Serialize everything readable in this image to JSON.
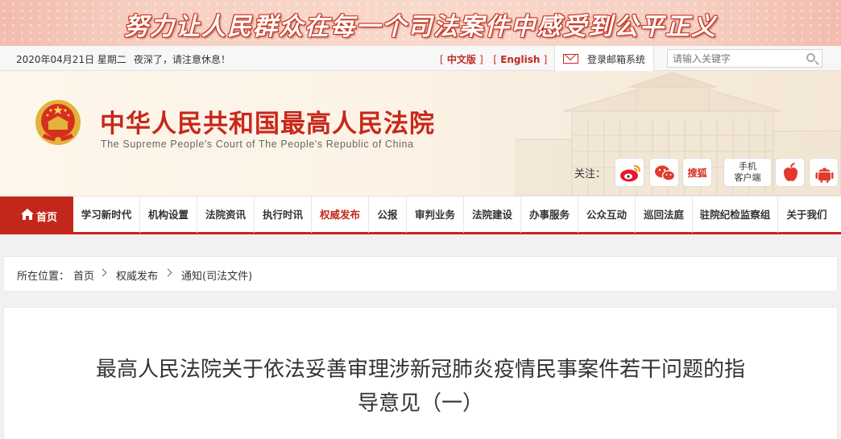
{
  "banner": {
    "slogan": "努力让人民群众在每一个司法案件中感受到公平正义"
  },
  "topbar": {
    "date": "2020年04月21日 星期二",
    "greeting": "夜深了，请注意休息！",
    "lang_cn": "中文版",
    "lang_en": "English",
    "mail_label": "登录邮箱系统",
    "search_placeholder": "请输入关键字"
  },
  "header": {
    "title": "中华人民共和国最高人民法院",
    "subtitle": "The Supreme People's Court of The People's Republic of China",
    "follow_label": "关注：",
    "sohu_label": "搜狐",
    "mobile_label_1": "手机",
    "mobile_label_2": "客户端"
  },
  "nav": {
    "home": "首页",
    "items": [
      "学习新时代",
      "机构设置",
      "法院资讯",
      "执行时讯",
      "权威发布",
      "公报",
      "审判业务",
      "法院建设",
      "办事服务",
      "公众互动",
      "巡回法庭",
      "驻院纪检监察组",
      "关于我们"
    ],
    "active_index": 4
  },
  "breadcrumb": {
    "prefix": "所在位置：",
    "items": [
      "首页",
      "权威发布",
      "通知(司法文件)"
    ]
  },
  "article": {
    "title": "最高人民法院关于依法妥善审理涉新冠肺炎疫情民事案件若干问题的指导意见（一）"
  },
  "colors": {
    "brand_red": "#c3271b",
    "header_bg": "#fdf6ea"
  }
}
